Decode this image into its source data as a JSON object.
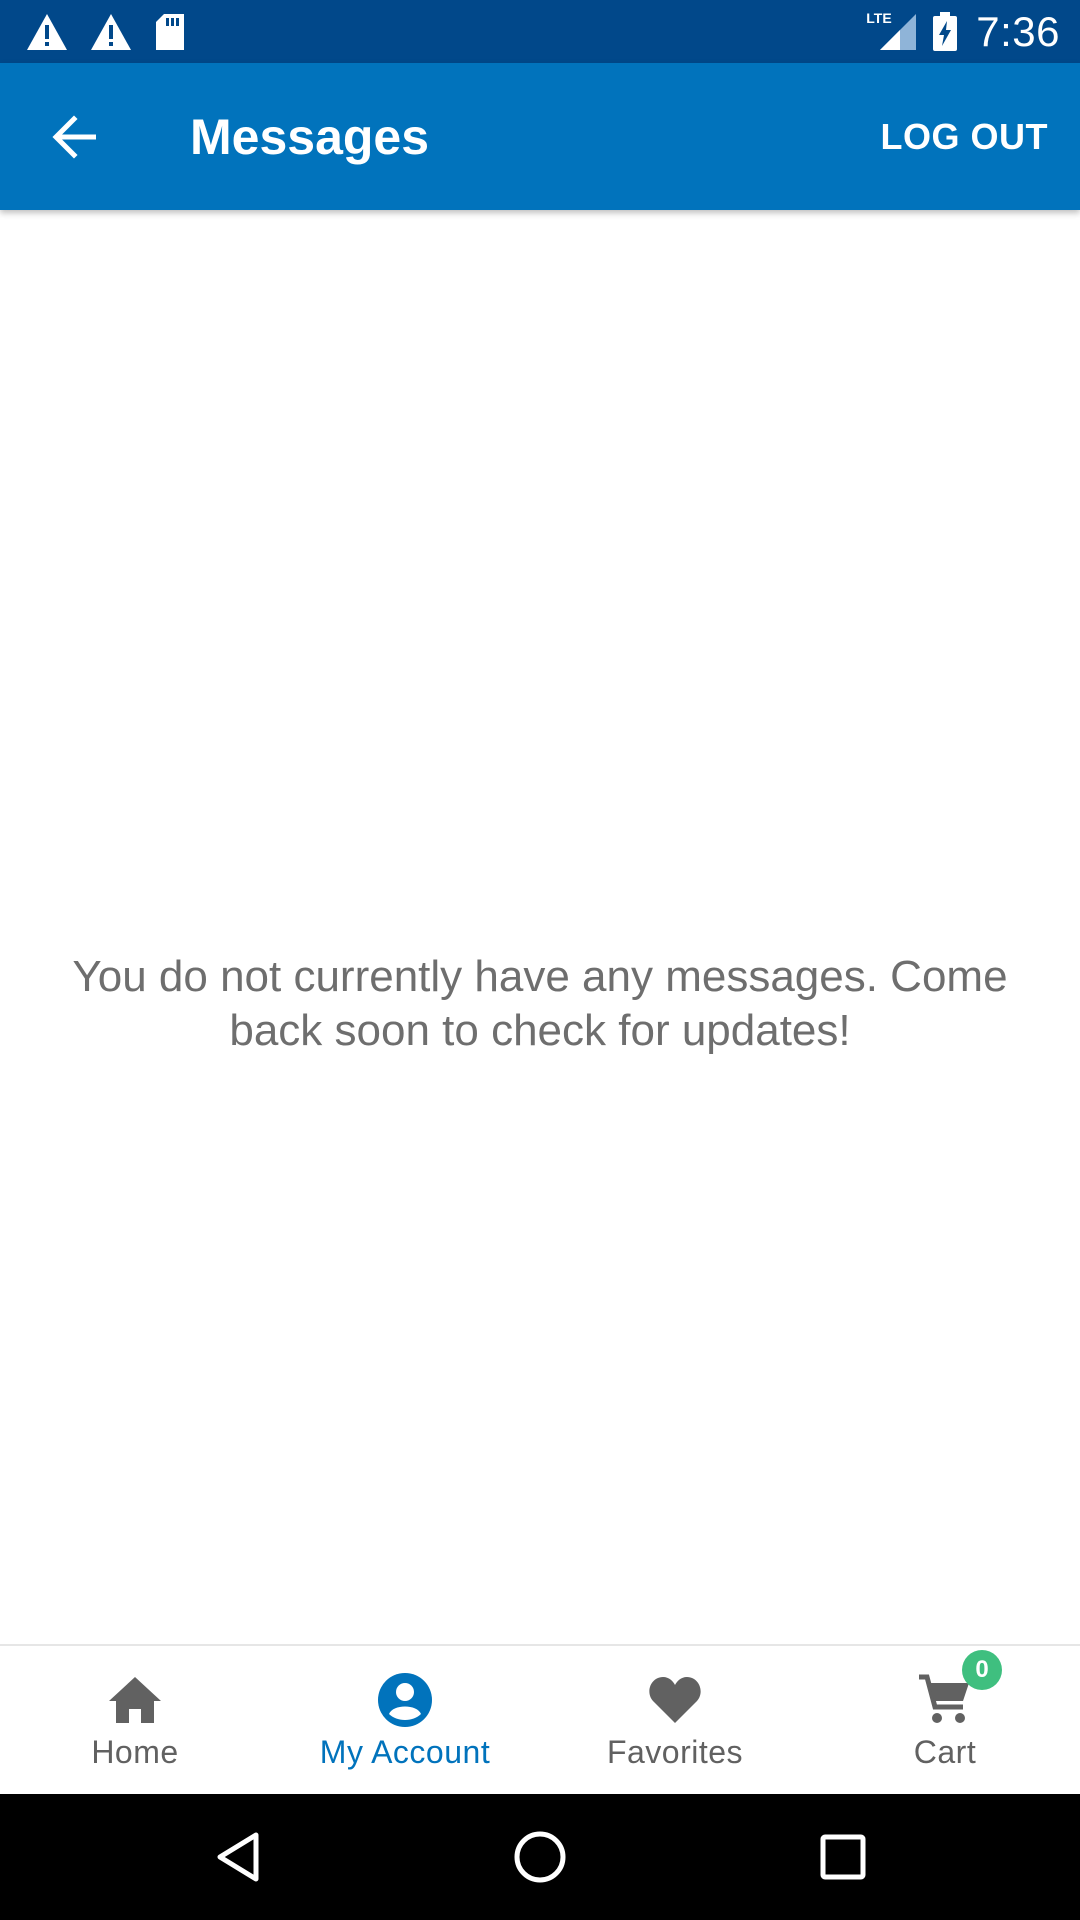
{
  "status_bar": {
    "time": "7:36",
    "network": "LTE",
    "icons": [
      "warning-icon",
      "warning-icon",
      "sd-card-icon",
      "signal-icon",
      "battery-charging-icon"
    ]
  },
  "app_bar": {
    "title": "Messages",
    "logout_label": "LOG OUT",
    "back_icon": "arrow-back-icon"
  },
  "content": {
    "empty_message": "You do not currently have any messages. Come back soon to check for updates!"
  },
  "bottom_nav": {
    "items": [
      {
        "label": "Home",
        "icon": "home-icon",
        "active": false
      },
      {
        "label": "My Account",
        "icon": "account-icon",
        "active": true
      },
      {
        "label": "Favorites",
        "icon": "heart-icon",
        "active": false
      },
      {
        "label": "Cart",
        "icon": "cart-icon",
        "active": false,
        "badge": "0"
      }
    ]
  },
  "colors": {
    "status_bar": "#01488a",
    "app_bar": "#0173bc",
    "accent": "#0173bc",
    "badge": "#3fbf7f",
    "inactive": "#616161",
    "message_text": "#6e6e6e"
  }
}
